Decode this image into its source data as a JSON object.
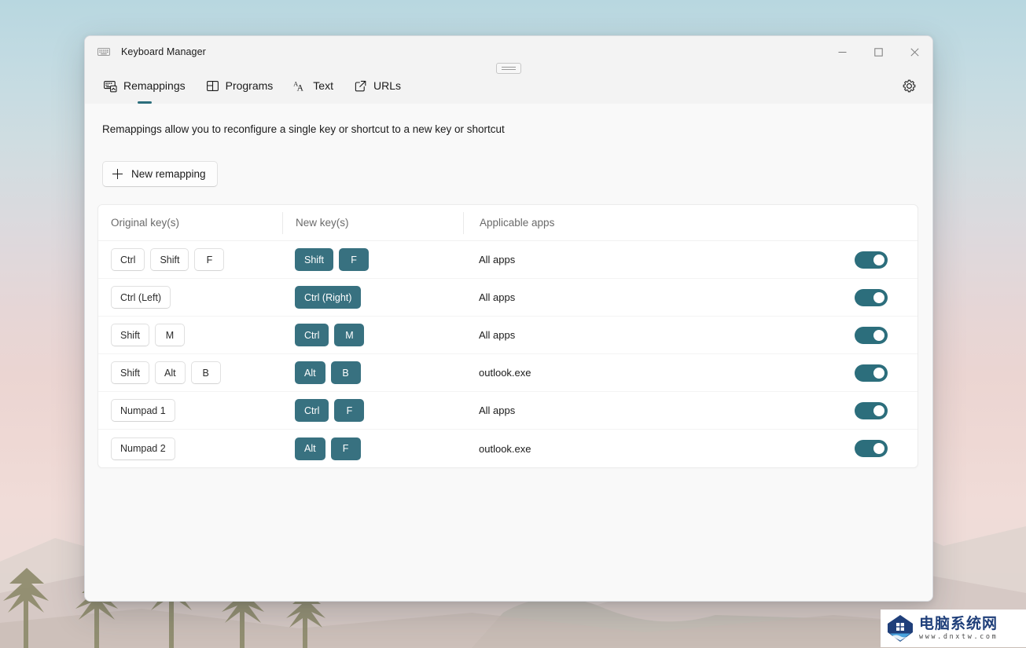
{
  "window": {
    "app_icon": "keyboard-icon",
    "title": "Keyboard Manager",
    "controls": {
      "minimize": "—",
      "maximize": "□",
      "close": "✕"
    }
  },
  "tabs": [
    {
      "id": "remappings",
      "label": "Remappings",
      "icon": "keyboard-remap-icon",
      "active": true
    },
    {
      "id": "programs",
      "label": "Programs",
      "icon": "grid-layout-icon",
      "active": false
    },
    {
      "id": "text",
      "label": "Text",
      "icon": "font-aa-icon",
      "active": false
    },
    {
      "id": "urls",
      "label": "URLs",
      "icon": "external-link-icon",
      "active": false
    }
  ],
  "settings_icon": "gear-icon",
  "main": {
    "description": "Remappings allow you to reconfigure a single key or shortcut to a new key or shortcut",
    "new_remapping_label": "New remapping",
    "new_remapping_icon": "plus-icon",
    "table": {
      "headers": {
        "original": "Original key(s)",
        "new": "New key(s)",
        "apps": "Applicable apps"
      },
      "rows": [
        {
          "original_keys": [
            "Ctrl",
            "Shift",
            "F"
          ],
          "new_keys": [
            "Shift",
            "F"
          ],
          "apps": "All apps",
          "enabled": true
        },
        {
          "original_keys": [
            "Ctrl (Left)"
          ],
          "new_keys": [
            "Ctrl (Right)"
          ],
          "apps": "All apps",
          "enabled": true
        },
        {
          "original_keys": [
            "Shift",
            "M"
          ],
          "new_keys": [
            "Ctrl",
            "M"
          ],
          "apps": "All apps",
          "enabled": true
        },
        {
          "original_keys": [
            "Shift",
            "Alt",
            "B"
          ],
          "new_keys": [
            "Alt",
            "B"
          ],
          "apps": "outlook.exe",
          "enabled": true
        },
        {
          "original_keys": [
            "Numpad 1"
          ],
          "new_keys": [
            "Ctrl",
            "F"
          ],
          "apps": "All apps",
          "enabled": true
        },
        {
          "original_keys": [
            "Numpad 2"
          ],
          "new_keys": [
            "Alt",
            "F"
          ],
          "apps": "outlook.exe",
          "enabled": true
        }
      ]
    }
  },
  "watermark": {
    "name_cn": "电脑系统网",
    "url": "www.dnxtw.com",
    "logo_icon": "house-logo-icon"
  },
  "colors": {
    "accent_teal": "#387180",
    "toggle_on": "#2c6e7c",
    "tab_indicator": "#2c6e7c",
    "titlebar_bg": "#f3f3f3",
    "content_bg": "#f9f9f9",
    "card_bg": "#ffffff",
    "watermark_blue": "#1f3f7a"
  }
}
